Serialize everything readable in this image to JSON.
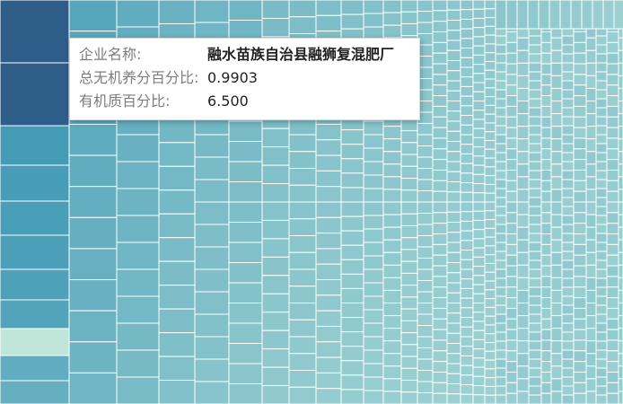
{
  "chart_data": {
    "type": "treemap",
    "colors": {
      "dark": "#2f5d8a",
      "mid": "#3f98b5",
      "light": "#9fd2d2",
      "mint": "#bfe5d9",
      "border": "#ffffff"
    },
    "hovered_index": 0
  },
  "tooltip": {
    "name_key": "企业名称:",
    "name_value": "融水苗族自治县融狮复混肥厂",
    "nutrient_key": "总无机养分百分比:",
    "nutrient_value": "0.9903",
    "organic_key": "有机质百分比:",
    "organic_value": "6.500"
  }
}
